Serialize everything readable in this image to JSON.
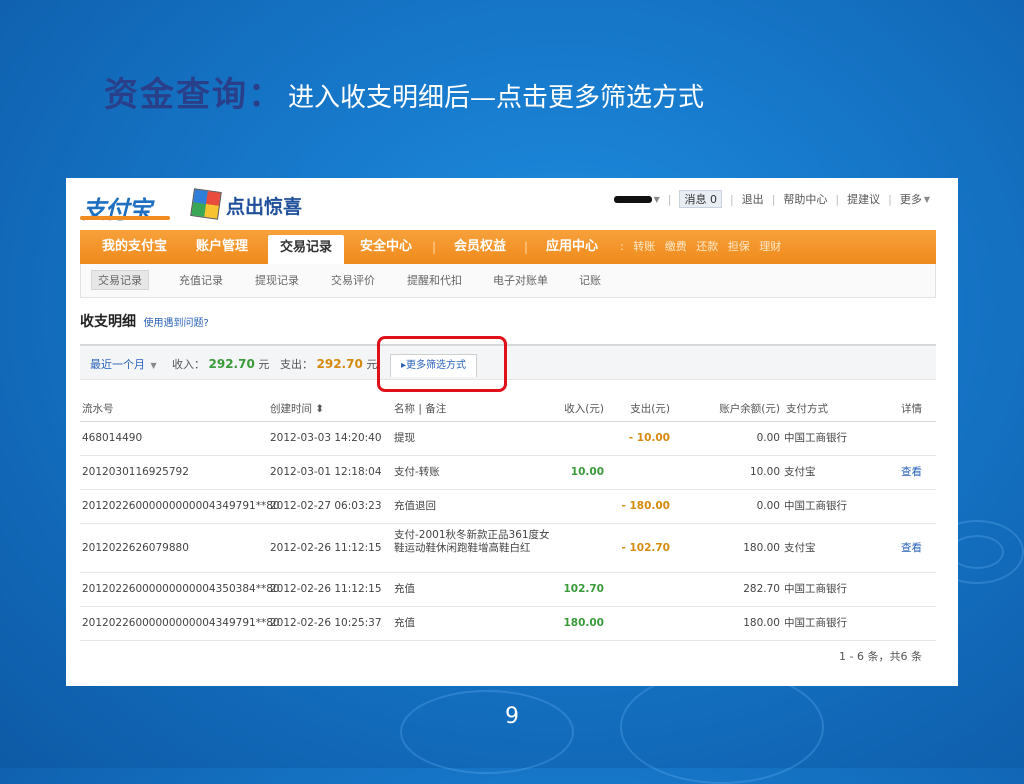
{
  "slide": {
    "title_main": "资金查询：",
    "title_sub": "进入收支明细后—点击更多筛选方式",
    "page_number": "9"
  },
  "site": {
    "logo_text": "支付宝",
    "slogan": "点出惊喜",
    "top_links": {
      "messages_label": "消息",
      "messages_count": "0",
      "logout": "退出",
      "help": "帮助中心",
      "suggest": "提建议",
      "more": "更多"
    }
  },
  "nav": {
    "items": [
      "我的支付宝",
      "账户管理",
      "交易记录",
      "安全中心",
      "会员权益",
      "应用中心"
    ],
    "quick_links": [
      "转账",
      "缴费",
      "还款",
      "担保",
      "理财"
    ]
  },
  "subnav": {
    "items": [
      "交易记录",
      "充值记录",
      "提现记录",
      "交易评价",
      "提醒和代扣",
      "电子对账单",
      "记账"
    ]
  },
  "detail": {
    "title": "收支明细",
    "help_link": "使用遇到问题?",
    "period": "最近一个月",
    "income_label": "收入：",
    "income_value": "292.70",
    "expense_label": "支出：",
    "expense_value": "292.70",
    "currency": "元",
    "more_filter": "更多筛选方式"
  },
  "table": {
    "headers": {
      "serial": "流水号",
      "time": "创建时间",
      "name": "名称 | 备注",
      "income": "收入(元)",
      "expense": "支出(元)",
      "balance": "账户余额(元)",
      "method": "支付方式",
      "detail": "详情"
    },
    "rows": [
      {
        "serial": "468014490",
        "time": "2012-03-03 14:20:40",
        "name": "提现",
        "income": "",
        "expense": "- 10.00",
        "balance": "0.00",
        "method": "中国工商银行",
        "detail": ""
      },
      {
        "serial": "2012030116925792",
        "time": "2012-03-01 12:18:04",
        "name": "支付-转账",
        "income": "10.00",
        "expense": "",
        "balance": "10.00",
        "method": "支付宝",
        "detail": "查看"
      },
      {
        "serial": "20120226000000000004349791**80",
        "time": "2012-02-27 06:03:23",
        "name": "充值退回",
        "income": "",
        "expense": "- 180.00",
        "balance": "0.00",
        "method": "中国工商银行",
        "detail": ""
      },
      {
        "serial": "2012022626079880",
        "time": "2012-02-26 11:12:15",
        "name": "支付-2001秋冬新款正品361度女鞋运动鞋休闲跑鞋增高鞋白红",
        "income": "",
        "expense": "- 102.70",
        "balance": "180.00",
        "method": "支付宝",
        "detail": "查看"
      },
      {
        "serial": "20120226000000000004350384**80",
        "time": "2012-02-26 11:12:15",
        "name": "充值",
        "income": "102.70",
        "expense": "",
        "balance": "282.70",
        "method": "中国工商银行",
        "detail": ""
      },
      {
        "serial": "20120226000000000004349791**80",
        "time": "2012-02-26 10:25:37",
        "name": "充值",
        "income": "180.00",
        "expense": "",
        "balance": "180.00",
        "method": "中国工商银行",
        "detail": ""
      }
    ],
    "pager": "1 - 6 条，共6 条"
  }
}
